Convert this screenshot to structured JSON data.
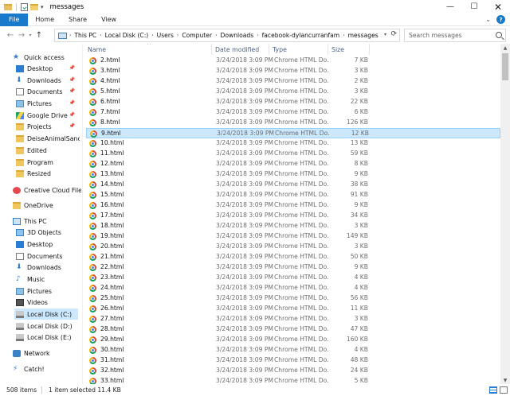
{
  "window": {
    "title": "messages",
    "controls": {
      "minimize": "—",
      "maximize": "☐",
      "close": "✕"
    }
  },
  "ribbon": {
    "tabs": [
      "File",
      "Home",
      "Share",
      "View"
    ],
    "expand": "⌄",
    "help": "?"
  },
  "nav": {
    "back": "←",
    "forward": "→",
    "recent": "▾",
    "up": "↑"
  },
  "address": {
    "crumbs": [
      "This PC",
      "Local Disk (C:)",
      "Users",
      "Computer",
      "Downloads",
      "facebook-dylancurranfam",
      "messages"
    ],
    "separator": "›",
    "dropdown": "▾",
    "refresh": "⟳"
  },
  "search": {
    "placeholder": "Search messages"
  },
  "sidebar": {
    "items": [
      {
        "label": "Quick access",
        "icon": "star-icon",
        "pinned": false
      },
      {
        "label": "Desktop",
        "icon": "desktop-icon",
        "pinned": true
      },
      {
        "label": "Downloads",
        "icon": "downloads-icon",
        "pinned": true
      },
      {
        "label": "Documents",
        "icon": "documents-icon",
        "pinned": true
      },
      {
        "label": "Pictures",
        "icon": "pictures-icon",
        "pinned": true
      },
      {
        "label": "Google Drive",
        "icon": "google-drive-icon",
        "pinned": true
      },
      {
        "label": "Projects",
        "icon": "folder-icon",
        "pinned": true
      },
      {
        "label": "DeiseAnimalSanctu",
        "icon": "folder-icon",
        "pinned": false
      },
      {
        "label": "Edited",
        "icon": "folder-icon",
        "pinned": false
      },
      {
        "label": "Program",
        "icon": "folder-icon",
        "pinned": false
      },
      {
        "label": "Resized",
        "icon": "folder-icon",
        "pinned": false
      },
      {
        "label": "Creative Cloud Files",
        "icon": "creative-cloud-icon",
        "pinned": false
      },
      {
        "label": "OneDrive",
        "icon": "onedrive-icon",
        "pinned": false
      },
      {
        "label": "This PC",
        "icon": "this-pc-icon",
        "pinned": false
      },
      {
        "label": "3D Objects",
        "icon": "3d-objects-icon",
        "pinned": false
      },
      {
        "label": "Desktop",
        "icon": "desktop-icon",
        "pinned": false
      },
      {
        "label": "Documents",
        "icon": "documents-icon",
        "pinned": false
      },
      {
        "label": "Downloads",
        "icon": "downloads-icon",
        "pinned": false
      },
      {
        "label": "Music",
        "icon": "music-icon",
        "pinned": false
      },
      {
        "label": "Pictures",
        "icon": "pictures-icon",
        "pinned": false
      },
      {
        "label": "Videos",
        "icon": "videos-icon",
        "pinned": false
      },
      {
        "label": "Local Disk (C:)",
        "icon": "drive-icon",
        "pinned": false,
        "selected": true
      },
      {
        "label": "Local Disk (D:)",
        "icon": "drive-icon",
        "pinned": false
      },
      {
        "label": "Local Disk (E:)",
        "icon": "drive-icon",
        "pinned": false
      },
      {
        "label": "Network",
        "icon": "network-icon",
        "pinned": false
      },
      {
        "label": "Catch!",
        "icon": "catch-icon",
        "pinned": false
      }
    ]
  },
  "columns": {
    "name": "Name",
    "date": "Date modified",
    "type": "Type",
    "size": "Size",
    "sort_indicator": "^"
  },
  "files": [
    {
      "name": "2.html",
      "date": "3/24/2018 3:09 PM",
      "type": "Chrome HTML Do...",
      "size": "7 KB"
    },
    {
      "name": "3.html",
      "date": "3/24/2018 3:09 PM",
      "type": "Chrome HTML Do...",
      "size": "3 KB"
    },
    {
      "name": "4.html",
      "date": "3/24/2018 3:09 PM",
      "type": "Chrome HTML Do...",
      "size": "2 KB"
    },
    {
      "name": "5.html",
      "date": "3/24/2018 3:09 PM",
      "type": "Chrome HTML Do...",
      "size": "3 KB"
    },
    {
      "name": "6.html",
      "date": "3/24/2018 3:09 PM",
      "type": "Chrome HTML Do...",
      "size": "22 KB"
    },
    {
      "name": "7.html",
      "date": "3/24/2018 3:09 PM",
      "type": "Chrome HTML Do...",
      "size": "6 KB"
    },
    {
      "name": "8.html",
      "date": "3/24/2018 3:09 PM",
      "type": "Chrome HTML Do...",
      "size": "126 KB"
    },
    {
      "name": "9.html",
      "date": "3/24/2018 3:09 PM",
      "type": "Chrome HTML Do...",
      "size": "12 KB",
      "selected": true
    },
    {
      "name": "10.html",
      "date": "3/24/2018 3:09 PM",
      "type": "Chrome HTML Do...",
      "size": "13 KB"
    },
    {
      "name": "11.html",
      "date": "3/24/2018 3:09 PM",
      "type": "Chrome HTML Do...",
      "size": "59 KB"
    },
    {
      "name": "12.html",
      "date": "3/24/2018 3:09 PM",
      "type": "Chrome HTML Do...",
      "size": "8 KB"
    },
    {
      "name": "13.html",
      "date": "3/24/2018 3:09 PM",
      "type": "Chrome HTML Do...",
      "size": "9 KB"
    },
    {
      "name": "14.html",
      "date": "3/24/2018 3:09 PM",
      "type": "Chrome HTML Do...",
      "size": "38 KB"
    },
    {
      "name": "15.html",
      "date": "3/24/2018 3:09 PM",
      "type": "Chrome HTML Do...",
      "size": "91 KB"
    },
    {
      "name": "16.html",
      "date": "3/24/2018 3:09 PM",
      "type": "Chrome HTML Do...",
      "size": "9 KB"
    },
    {
      "name": "17.html",
      "date": "3/24/2018 3:09 PM",
      "type": "Chrome HTML Do...",
      "size": "34 KB"
    },
    {
      "name": "18.html",
      "date": "3/24/2018 3:09 PM",
      "type": "Chrome HTML Do...",
      "size": "3 KB"
    },
    {
      "name": "19.html",
      "date": "3/24/2018 3:09 PM",
      "type": "Chrome HTML Do...",
      "size": "149 KB"
    },
    {
      "name": "20.html",
      "date": "3/24/2018 3:09 PM",
      "type": "Chrome HTML Do...",
      "size": "3 KB"
    },
    {
      "name": "21.html",
      "date": "3/24/2018 3:09 PM",
      "type": "Chrome HTML Do...",
      "size": "50 KB"
    },
    {
      "name": "22.html",
      "date": "3/24/2018 3:09 PM",
      "type": "Chrome HTML Do...",
      "size": "9 KB"
    },
    {
      "name": "23.html",
      "date": "3/24/2018 3:09 PM",
      "type": "Chrome HTML Do...",
      "size": "4 KB"
    },
    {
      "name": "24.html",
      "date": "3/24/2018 3:09 PM",
      "type": "Chrome HTML Do...",
      "size": "4 KB"
    },
    {
      "name": "25.html",
      "date": "3/24/2018 3:09 PM",
      "type": "Chrome HTML Do...",
      "size": "56 KB"
    },
    {
      "name": "26.html",
      "date": "3/24/2018 3:09 PM",
      "type": "Chrome HTML Do...",
      "size": "11 KB"
    },
    {
      "name": "27.html",
      "date": "3/24/2018 3:09 PM",
      "type": "Chrome HTML Do...",
      "size": "3 KB"
    },
    {
      "name": "28.html",
      "date": "3/24/2018 3:09 PM",
      "type": "Chrome HTML Do...",
      "size": "47 KB"
    },
    {
      "name": "29.html",
      "date": "3/24/2018 3:09 PM",
      "type": "Chrome HTML Do...",
      "size": "160 KB"
    },
    {
      "name": "30.html",
      "date": "3/24/2018 3:09 PM",
      "type": "Chrome HTML Do...",
      "size": "4 KB"
    },
    {
      "name": "31.html",
      "date": "3/24/2018 3:09 PM",
      "type": "Chrome HTML Do...",
      "size": "48 KB"
    },
    {
      "name": "32.html",
      "date": "3/24/2018 3:09 PM",
      "type": "Chrome HTML Do...",
      "size": "24 KB"
    },
    {
      "name": "33.html",
      "date": "3/24/2018 3:09 PM",
      "type": "Chrome HTML Do...",
      "size": "5 KB"
    }
  ],
  "scrollbar": {
    "up": "▲",
    "down": "▼"
  },
  "status": {
    "item_count": "508 items",
    "selection": "1 item selected  11.4 KB"
  },
  "colors": {
    "accent": "#1979ca",
    "selection": "#cce8ff",
    "selection_border": "#99d1ff",
    "header_text": "#4d6185"
  }
}
